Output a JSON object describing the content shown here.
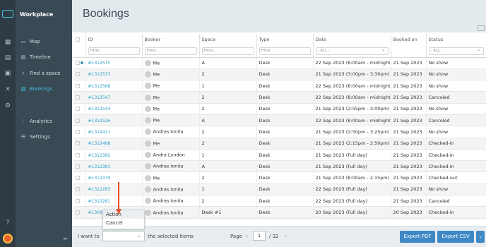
{
  "app": {
    "brand": "Workplace",
    "page_title": "Bookings"
  },
  "colors": {
    "accent": "#46c0e0",
    "link": "#2a9fc9",
    "button": "#3f88c5",
    "annotation_arrow": "#e8512f"
  },
  "rail_icons": [
    "logo-icon",
    "map-icon",
    "calendar-icon",
    "contacts-icon",
    "tools-icon",
    "settings-icon",
    "help-icon",
    "avatar"
  ],
  "nav": [
    {
      "label": "Map",
      "icon": "map-icon"
    },
    {
      "label": "Timeline",
      "icon": "timeline-icon"
    },
    {
      "label": "Find a space",
      "icon": "search-icon"
    },
    {
      "label": "Bookings",
      "icon": "bookings-icon",
      "active": true
    },
    {
      "label": "Analytics",
      "icon": "analytics-icon"
    },
    {
      "label": "Settings",
      "icon": "sliders-icon"
    }
  ],
  "table": {
    "columns": [
      "ID",
      "Booker",
      "Space",
      "Type",
      "Date",
      "Booked on",
      "Status"
    ],
    "filters": {
      "placeholder": "Filter...",
      "date_all": "- ALL -",
      "status_all": "- ALL -"
    },
    "rows": [
      {
        "id": "#1312575",
        "booker": "Me",
        "space": "A",
        "type": "Desk",
        "date": "22 Sep 2023 (8:00am - midnight)",
        "booked_on": "21 Sep 2023",
        "status": "No show"
      },
      {
        "id": "#1312573",
        "booker": "Me",
        "space": "2",
        "type": "Desk",
        "date": "21 Sep 2023 (3:00pm - 3:30pm)",
        "booked_on": "21 Sep 2023",
        "status": "No show"
      },
      {
        "id": "#1312568",
        "booker": "Me",
        "space": "1",
        "type": "Desk",
        "date": "22 Sep 2023 (8:00am - midnight)",
        "booked_on": "21 Sep 2023",
        "status": "No show"
      },
      {
        "id": "#1312547",
        "booker": "Me",
        "space": "2",
        "type": "Desk",
        "date": "22 Sep 2023 (8:00am - midnight)",
        "booked_on": "21 Sep 2023",
        "status": "Canceled"
      },
      {
        "id": "#1312543",
        "booker": "Me",
        "space": "2",
        "type": "Desk",
        "date": "21 Sep 2023 (2:55pm - 3:00pm)",
        "booked_on": "21 Sep 2023",
        "status": "No show"
      },
      {
        "id": "#1312526",
        "booker": "Me",
        "space": "A",
        "type": "Desk",
        "date": "22 Sep 2023 (8:00am - midnight)",
        "booked_on": "21 Sep 2023",
        "status": "Canceled"
      },
      {
        "id": "#1312411",
        "booker": "Andras Ionita",
        "space": "2",
        "type": "Desk",
        "date": "21 Sep 2023 (2:50pm - 3:25pm)",
        "booked_on": "21 Sep 2023",
        "status": "No show"
      },
      {
        "id": "#1312408",
        "booker": "Me",
        "space": "2",
        "type": "Desk",
        "date": "21 Sep 2023 (2:15pm - 2:50pm)",
        "booked_on": "21 Sep 2023",
        "status": "Checked-in"
      },
      {
        "id": "#1312392",
        "booker": "Andra London",
        "space": "1",
        "type": "Desk",
        "date": "21 Sep 2023 (Full day)",
        "booked_on": "21 Sep 2023",
        "status": "Checked-in"
      },
      {
        "id": "#1312381",
        "booker": "Andras Ionita",
        "space": "A",
        "type": "Desk",
        "date": "21 Sep 2023 (Full day)",
        "booked_on": "21 Sep 2023",
        "status": "Checked-in"
      },
      {
        "id": "#1312379",
        "booker": "Me",
        "space": "2",
        "type": "Desk",
        "date": "21 Sep 2023 (8:00am - 2:15pm)",
        "booked_on": "21 Sep 2023",
        "status": "Checked-out"
      },
      {
        "id": "#1312283",
        "booker": "Andras Ionita",
        "space": "1",
        "type": "Desk",
        "date": "22 Sep 2023 (Full day)",
        "booked_on": "21 Sep 2023",
        "status": "No show"
      },
      {
        "id": "#1312281",
        "booker": "Andras Ionita",
        "space": "2",
        "type": "Desk",
        "date": "22 Sep 2023 (Full day)",
        "booked_on": "21 Sep 2023",
        "status": "Canceled"
      },
      {
        "id": "#130911",
        "booker": "Andras Ionita",
        "space": "Desk #1",
        "type": "Desk",
        "date": "20 Sep 2023 (Full day)",
        "booked_on": "20 Sep 2023",
        "status": "Checked-in"
      }
    ]
  },
  "footer": {
    "i_want_to": "I want to",
    "selected_items": "the selected items",
    "page_label": "Page",
    "page_current": "1",
    "page_total": "/ 32",
    "export_pdf": "Export PDF",
    "export_csv": "Export CSV"
  },
  "action_dropdown": {
    "options": [
      "Action",
      "Cancel"
    ]
  }
}
